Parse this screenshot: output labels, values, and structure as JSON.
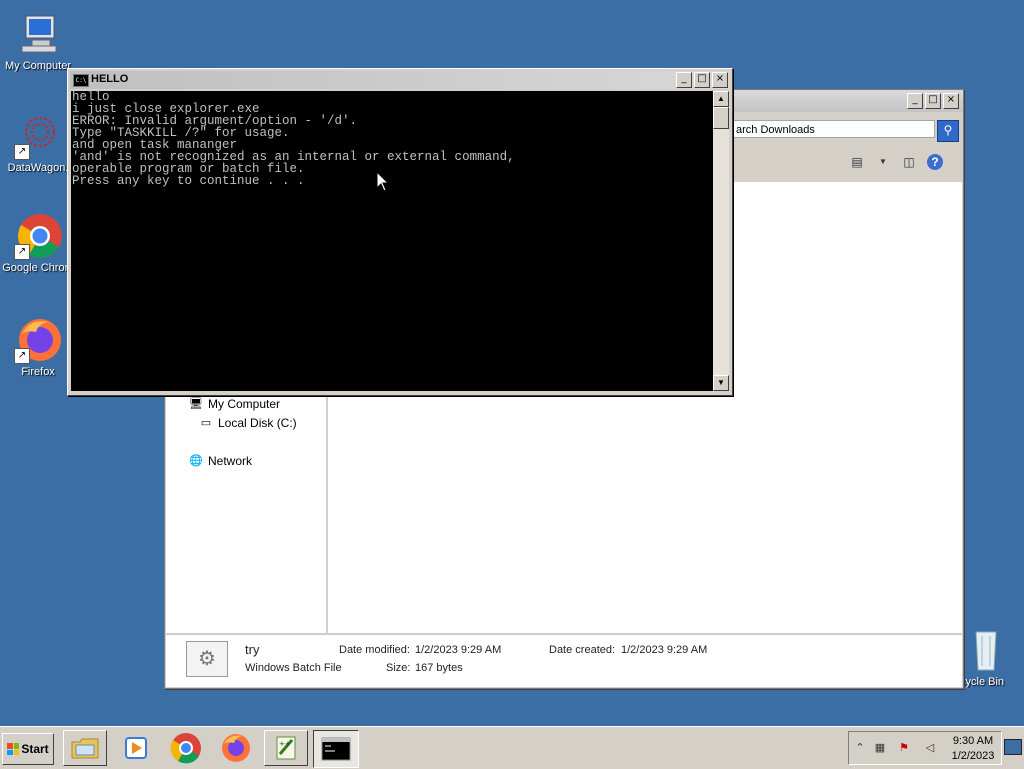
{
  "desktop": {
    "icons": [
      {
        "label": "My Computer",
        "icon": "computer-icon"
      },
      {
        "label": "DataWagon.",
        "icon": "datawagon-icon"
      },
      {
        "label": "Google Chrom",
        "icon": "chrome-icon"
      },
      {
        "label": "Firefox",
        "icon": "firefox-icon"
      },
      {
        "label": "cycle Bin",
        "icon": "recycle-bin-icon"
      }
    ]
  },
  "console": {
    "title": "HELLO",
    "icon_text": "C:\\",
    "lines": [
      "hello",
      "i just close explorer.exe",
      "ERROR: Invalid argument/option - '/d'.",
      "Type \"TASKKILL /?\" for usage.",
      "and open task mananger",
      "'and' is not recognized as an internal or external command,",
      "operable program or batch file.",
      "Press any key to continue . . ."
    ]
  },
  "explorer": {
    "search_text": "arch Downloads",
    "nav": [
      {
        "label": "My Computer",
        "icon": "computer-icon"
      },
      {
        "label": "Local Disk (C:)",
        "icon": "drive-icon"
      },
      {
        "label": "Network",
        "icon": "network-icon"
      }
    ],
    "details": {
      "name": "try",
      "type": "Windows Batch File",
      "modified_label": "Date modified:",
      "modified_value": "1/2/2023 9:29 AM",
      "created_label": "Date created:",
      "created_value": "1/2/2023 9:29 AM",
      "size_label": "Size:",
      "size_value": "167 bytes"
    }
  },
  "taskbar": {
    "start_label": "Start",
    "clock_time": "9:30 AM",
    "clock_date": "1/2/2023"
  },
  "colors": {
    "desktop": "#3a6ea5",
    "console_bg": "#000000",
    "console_text": "#c0c0c0"
  }
}
